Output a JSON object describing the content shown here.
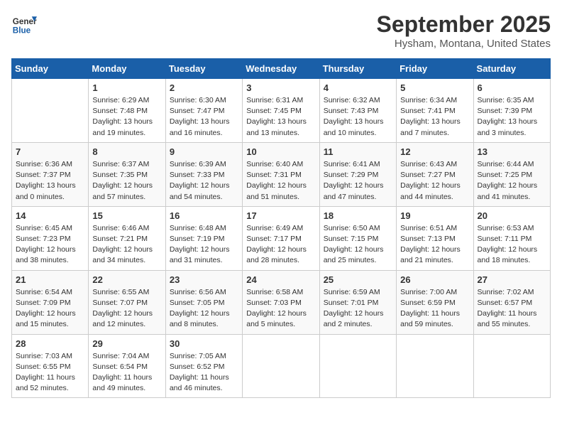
{
  "logo": {
    "line1": "General",
    "line2": "Blue"
  },
  "title": "September 2025",
  "subtitle": "Hysham, Montana, United States",
  "weekdays": [
    "Sunday",
    "Monday",
    "Tuesday",
    "Wednesday",
    "Thursday",
    "Friday",
    "Saturday"
  ],
  "weeks": [
    [
      {
        "day": "",
        "info": ""
      },
      {
        "day": "1",
        "info": "Sunrise: 6:29 AM\nSunset: 7:48 PM\nDaylight: 13 hours\nand 19 minutes."
      },
      {
        "day": "2",
        "info": "Sunrise: 6:30 AM\nSunset: 7:47 PM\nDaylight: 13 hours\nand 16 minutes."
      },
      {
        "day": "3",
        "info": "Sunrise: 6:31 AM\nSunset: 7:45 PM\nDaylight: 13 hours\nand 13 minutes."
      },
      {
        "day": "4",
        "info": "Sunrise: 6:32 AM\nSunset: 7:43 PM\nDaylight: 13 hours\nand 10 minutes."
      },
      {
        "day": "5",
        "info": "Sunrise: 6:34 AM\nSunset: 7:41 PM\nDaylight: 13 hours\nand 7 minutes."
      },
      {
        "day": "6",
        "info": "Sunrise: 6:35 AM\nSunset: 7:39 PM\nDaylight: 13 hours\nand 3 minutes."
      }
    ],
    [
      {
        "day": "7",
        "info": "Sunrise: 6:36 AM\nSunset: 7:37 PM\nDaylight: 13 hours\nand 0 minutes."
      },
      {
        "day": "8",
        "info": "Sunrise: 6:37 AM\nSunset: 7:35 PM\nDaylight: 12 hours\nand 57 minutes."
      },
      {
        "day": "9",
        "info": "Sunrise: 6:39 AM\nSunset: 7:33 PM\nDaylight: 12 hours\nand 54 minutes."
      },
      {
        "day": "10",
        "info": "Sunrise: 6:40 AM\nSunset: 7:31 PM\nDaylight: 12 hours\nand 51 minutes."
      },
      {
        "day": "11",
        "info": "Sunrise: 6:41 AM\nSunset: 7:29 PM\nDaylight: 12 hours\nand 47 minutes."
      },
      {
        "day": "12",
        "info": "Sunrise: 6:43 AM\nSunset: 7:27 PM\nDaylight: 12 hours\nand 44 minutes."
      },
      {
        "day": "13",
        "info": "Sunrise: 6:44 AM\nSunset: 7:25 PM\nDaylight: 12 hours\nand 41 minutes."
      }
    ],
    [
      {
        "day": "14",
        "info": "Sunrise: 6:45 AM\nSunset: 7:23 PM\nDaylight: 12 hours\nand 38 minutes."
      },
      {
        "day": "15",
        "info": "Sunrise: 6:46 AM\nSunset: 7:21 PM\nDaylight: 12 hours\nand 34 minutes."
      },
      {
        "day": "16",
        "info": "Sunrise: 6:48 AM\nSunset: 7:19 PM\nDaylight: 12 hours\nand 31 minutes."
      },
      {
        "day": "17",
        "info": "Sunrise: 6:49 AM\nSunset: 7:17 PM\nDaylight: 12 hours\nand 28 minutes."
      },
      {
        "day": "18",
        "info": "Sunrise: 6:50 AM\nSunset: 7:15 PM\nDaylight: 12 hours\nand 25 minutes."
      },
      {
        "day": "19",
        "info": "Sunrise: 6:51 AM\nSunset: 7:13 PM\nDaylight: 12 hours\nand 21 minutes."
      },
      {
        "day": "20",
        "info": "Sunrise: 6:53 AM\nSunset: 7:11 PM\nDaylight: 12 hours\nand 18 minutes."
      }
    ],
    [
      {
        "day": "21",
        "info": "Sunrise: 6:54 AM\nSunset: 7:09 PM\nDaylight: 12 hours\nand 15 minutes."
      },
      {
        "day": "22",
        "info": "Sunrise: 6:55 AM\nSunset: 7:07 PM\nDaylight: 12 hours\nand 12 minutes."
      },
      {
        "day": "23",
        "info": "Sunrise: 6:56 AM\nSunset: 7:05 PM\nDaylight: 12 hours\nand 8 minutes."
      },
      {
        "day": "24",
        "info": "Sunrise: 6:58 AM\nSunset: 7:03 PM\nDaylight: 12 hours\nand 5 minutes."
      },
      {
        "day": "25",
        "info": "Sunrise: 6:59 AM\nSunset: 7:01 PM\nDaylight: 12 hours\nand 2 minutes."
      },
      {
        "day": "26",
        "info": "Sunrise: 7:00 AM\nSunset: 6:59 PM\nDaylight: 11 hours\nand 59 minutes."
      },
      {
        "day": "27",
        "info": "Sunrise: 7:02 AM\nSunset: 6:57 PM\nDaylight: 11 hours\nand 55 minutes."
      }
    ],
    [
      {
        "day": "28",
        "info": "Sunrise: 7:03 AM\nSunset: 6:55 PM\nDaylight: 11 hours\nand 52 minutes."
      },
      {
        "day": "29",
        "info": "Sunrise: 7:04 AM\nSunset: 6:54 PM\nDaylight: 11 hours\nand 49 minutes."
      },
      {
        "day": "30",
        "info": "Sunrise: 7:05 AM\nSunset: 6:52 PM\nDaylight: 11 hours\nand 46 minutes."
      },
      {
        "day": "",
        "info": ""
      },
      {
        "day": "",
        "info": ""
      },
      {
        "day": "",
        "info": ""
      },
      {
        "day": "",
        "info": ""
      }
    ]
  ]
}
